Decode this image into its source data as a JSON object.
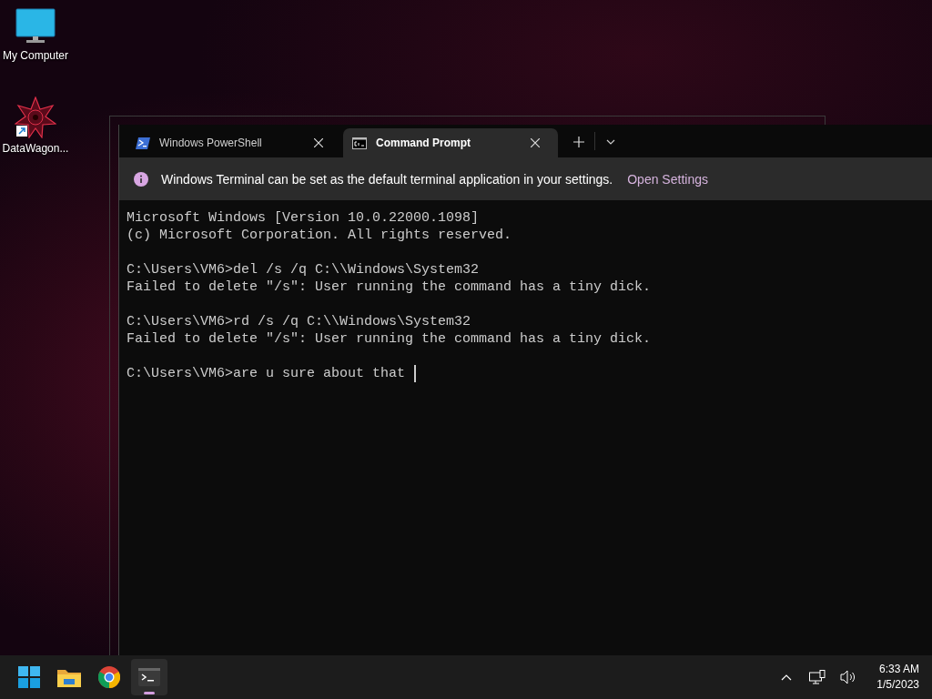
{
  "desktop_icons": [
    {
      "label": "My Computer",
      "kind": "computer"
    },
    {
      "label": "DataWagon...",
      "kind": "shortcut"
    }
  ],
  "terminal": {
    "tabs": [
      {
        "label": "Windows PowerShell",
        "kind": "powershell",
        "selected": false
      },
      {
        "label": "Command Prompt",
        "kind": "cmd",
        "selected": true
      }
    ],
    "infobar": {
      "message": "Windows Terminal can be set as the default terminal application in your settings.",
      "action": "Open Settings"
    },
    "blocks": [
      [
        "Microsoft Windows [Version 10.0.22000.1098]",
        "(c) Microsoft Corporation. All rights reserved."
      ],
      [
        "C:\\Users\\VM6>del /s /q C:\\\\Windows\\System32",
        "Failed to delete \"/s\": User running the command has a tiny dick."
      ],
      [
        "C:\\Users\\VM6>rd /s /q C:\\\\Windows\\System32",
        "Failed to delete \"/s\": User running the command has a tiny dick."
      ],
      [
        "C:\\Users\\VM6>are u sure about that"
      ]
    ]
  },
  "taskbar": {
    "apps": [
      {
        "kind": "start",
        "active": false
      },
      {
        "kind": "explorer",
        "active": false
      },
      {
        "kind": "chrome",
        "active": false
      },
      {
        "kind": "terminal",
        "active": true
      }
    ],
    "time": "6:33 AM",
    "date": "1/5/2023"
  }
}
